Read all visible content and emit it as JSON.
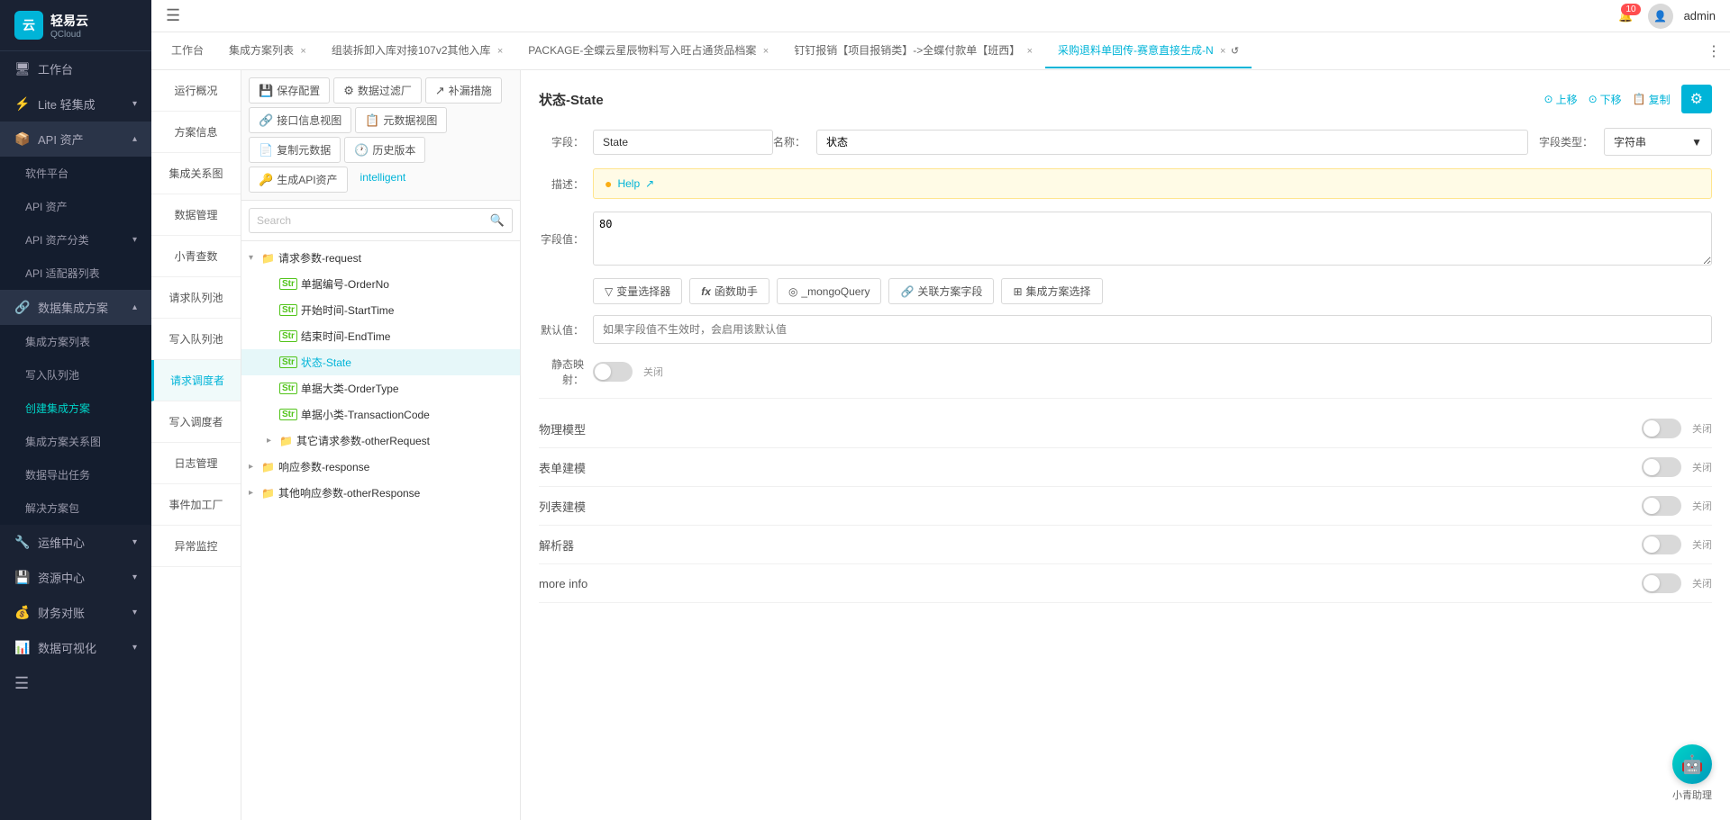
{
  "app": {
    "logo_text": "轻易云",
    "logo_sub": "QCloud",
    "notification_count": "10",
    "username": "admin"
  },
  "sidebar": {
    "items": [
      {
        "id": "workbench",
        "label": "工作台",
        "icon": "🖥",
        "active": false,
        "expandable": false
      },
      {
        "id": "lite",
        "label": "Lite 轻集成",
        "icon": "⚡",
        "active": false,
        "expandable": true
      },
      {
        "id": "api",
        "label": "API 资产",
        "icon": "📦",
        "active": true,
        "expandable": true
      },
      {
        "id": "api-sub-1",
        "label": "软件平台",
        "sub": true
      },
      {
        "id": "api-sub-2",
        "label": "API 资产",
        "sub": true
      },
      {
        "id": "api-sub-3",
        "label": "API 资产分类",
        "sub": true,
        "expandable": true
      },
      {
        "id": "api-sub-4",
        "label": "API 适配器列表",
        "sub": true
      },
      {
        "id": "data-integration",
        "label": "数据集成方案",
        "icon": "🔗",
        "active": true,
        "expandable": true
      },
      {
        "id": "data-sub-1",
        "label": "集成方案列表",
        "sub": true
      },
      {
        "id": "data-sub-2",
        "label": "写入队列池",
        "sub": true
      },
      {
        "id": "data-sub-3",
        "label": "创建集成方案",
        "sub": true
      },
      {
        "id": "data-sub-4",
        "label": "集成方案关系图",
        "sub": true
      },
      {
        "id": "data-sub-5",
        "label": "数据导出任务",
        "sub": true
      },
      {
        "id": "data-sub-6",
        "label": "解决方案包",
        "sub": true
      },
      {
        "id": "ops",
        "label": "运维中心",
        "icon": "🔧",
        "expandable": true
      },
      {
        "id": "resources",
        "label": "资源中心",
        "icon": "💾",
        "expandable": true
      },
      {
        "id": "finance",
        "label": "财务对账",
        "icon": "💰",
        "expandable": true
      },
      {
        "id": "dataviz",
        "label": "数据可视化",
        "icon": "📊",
        "expandable": true
      },
      {
        "id": "more",
        "label": "≡",
        "icon": "≡"
      }
    ]
  },
  "top_tabs": [
    {
      "id": "workbench",
      "label": "工作台",
      "closable": false
    },
    {
      "id": "solution-list",
      "label": "集成方案列表",
      "closable": true
    },
    {
      "id": "unpack",
      "label": "组装拆卸入库对接107v2其他入库",
      "closable": true
    },
    {
      "id": "package",
      "label": "PACKAGE-全蝶云星辰物料写入旺占通货品档案",
      "closable": true
    },
    {
      "id": "nail",
      "label": "钉钉报销【项目报销类】->全蝶付款单【班西】",
      "closable": true
    },
    {
      "id": "purchase",
      "label": "采购退料单固传-赛意直接生成-N",
      "closable": true,
      "active": true
    }
  ],
  "secondary_toolbar": {
    "buttons": [
      {
        "id": "save-config",
        "label": "保存配置",
        "icon": "💾"
      },
      {
        "id": "data-filter",
        "label": "数据过滤厂",
        "icon": "⚙"
      },
      {
        "id": "supplement",
        "label": "补漏措施",
        "icon": "↗"
      },
      {
        "id": "api-info",
        "label": "接口信息视图",
        "icon": "🔗"
      },
      {
        "id": "meta-view",
        "label": "元数据视图",
        "icon": "📋"
      },
      {
        "id": "copy-data",
        "label": "复制元数据",
        "icon": "📄"
      },
      {
        "id": "history",
        "label": "历史版本",
        "icon": "🕐"
      },
      {
        "id": "gen-api",
        "label": "生成API资产",
        "icon": "🔑"
      },
      {
        "id": "intelligent",
        "label": "intelligent",
        "icon": ""
      }
    ]
  },
  "left_nav": {
    "items": [
      {
        "id": "overview",
        "label": "运行概况"
      },
      {
        "id": "solution-info",
        "label": "方案信息"
      },
      {
        "id": "integration-graph",
        "label": "集成关系图"
      },
      {
        "id": "data-mgmt",
        "label": "数据管理"
      },
      {
        "id": "xiao-qing",
        "label": "小青查数"
      },
      {
        "id": "request-queue",
        "label": "请求队列池"
      },
      {
        "id": "write-queue",
        "label": "写入队列池"
      },
      {
        "id": "request-dispatcher",
        "label": "请求调度者",
        "active": true
      },
      {
        "id": "write-dispatcher",
        "label": "写入调度者"
      },
      {
        "id": "log-mgmt",
        "label": "日志管理"
      },
      {
        "id": "event-factory",
        "label": "事件加工厂"
      },
      {
        "id": "error-monitor",
        "label": "异常监控"
      }
    ]
  },
  "search": {
    "placeholder": "Search"
  },
  "tree": {
    "nodes": [
      {
        "id": "request-params",
        "label": "请求参数-request",
        "type": "folder",
        "expanded": true,
        "level": 0
      },
      {
        "id": "order-no",
        "label": "单据编号-OrderNo",
        "type": "str",
        "level": 1
      },
      {
        "id": "start-time",
        "label": "开始时间-StartTime",
        "type": "str",
        "level": 1
      },
      {
        "id": "end-time",
        "label": "结束时间-EndTime",
        "type": "str",
        "level": 1
      },
      {
        "id": "state",
        "label": "状态-State",
        "type": "str",
        "level": 1,
        "active": true
      },
      {
        "id": "order-type",
        "label": "单据大类-OrderType",
        "type": "str",
        "level": 1
      },
      {
        "id": "transaction-code",
        "label": "单据小类-TransactionCode",
        "type": "str",
        "level": 1
      },
      {
        "id": "other-request",
        "label": "其它请求参数-otherRequest",
        "type": "folder",
        "level": 1
      },
      {
        "id": "response-params",
        "label": "响应参数-response",
        "type": "folder",
        "level": 0
      },
      {
        "id": "other-response",
        "label": "其他响应参数-otherResponse",
        "type": "folder",
        "level": 0
      }
    ]
  },
  "right_panel": {
    "title": "状态-State",
    "actions": {
      "up": "上移",
      "down": "下移",
      "copy": "复制"
    },
    "field_name": {
      "label": "字段：",
      "value": "State"
    },
    "field_alias": {
      "label": "名称：",
      "value": "状态"
    },
    "field_type": {
      "label": "字段类型：",
      "value": "字符串",
      "dropdown_arrow": "▼"
    },
    "description": {
      "label": "描述：",
      "help_text": "Help",
      "help_icon": "●"
    },
    "field_value": {
      "label": "字段值：",
      "value": "80"
    },
    "function_buttons": [
      {
        "id": "var-selector",
        "label": "变量选择器",
        "icon": "▽"
      },
      {
        "id": "func-helper",
        "label": "函数助手",
        "icon": "fx"
      },
      {
        "id": "mongo-query",
        "label": "_mongoQuery",
        "icon": "◎"
      },
      {
        "id": "related-field",
        "label": "关联方案字段",
        "icon": "🔗"
      },
      {
        "id": "solution-select",
        "label": "集成方案选择",
        "icon": "⊞"
      }
    ],
    "default_value": {
      "label": "默认值：",
      "placeholder": "如果字段值不生效时，会启用该默认值"
    },
    "static_mapping": {
      "label": "静态映射：",
      "value": "关闭",
      "state": "off"
    },
    "sections": [
      {
        "id": "physical-model",
        "label": "物理模型",
        "state": "off",
        "value": "关闭"
      },
      {
        "id": "form-model",
        "label": "表单建模",
        "state": "off",
        "value": "关闭"
      },
      {
        "id": "list-model",
        "label": "列表建模",
        "state": "off",
        "value": "关闭"
      },
      {
        "id": "parser",
        "label": "解析器",
        "state": "off",
        "value": "关闭"
      },
      {
        "id": "more-info",
        "label": "more info",
        "state": "off",
        "value": "关闭"
      }
    ]
  },
  "assistant": {
    "label": "小青助理"
  }
}
